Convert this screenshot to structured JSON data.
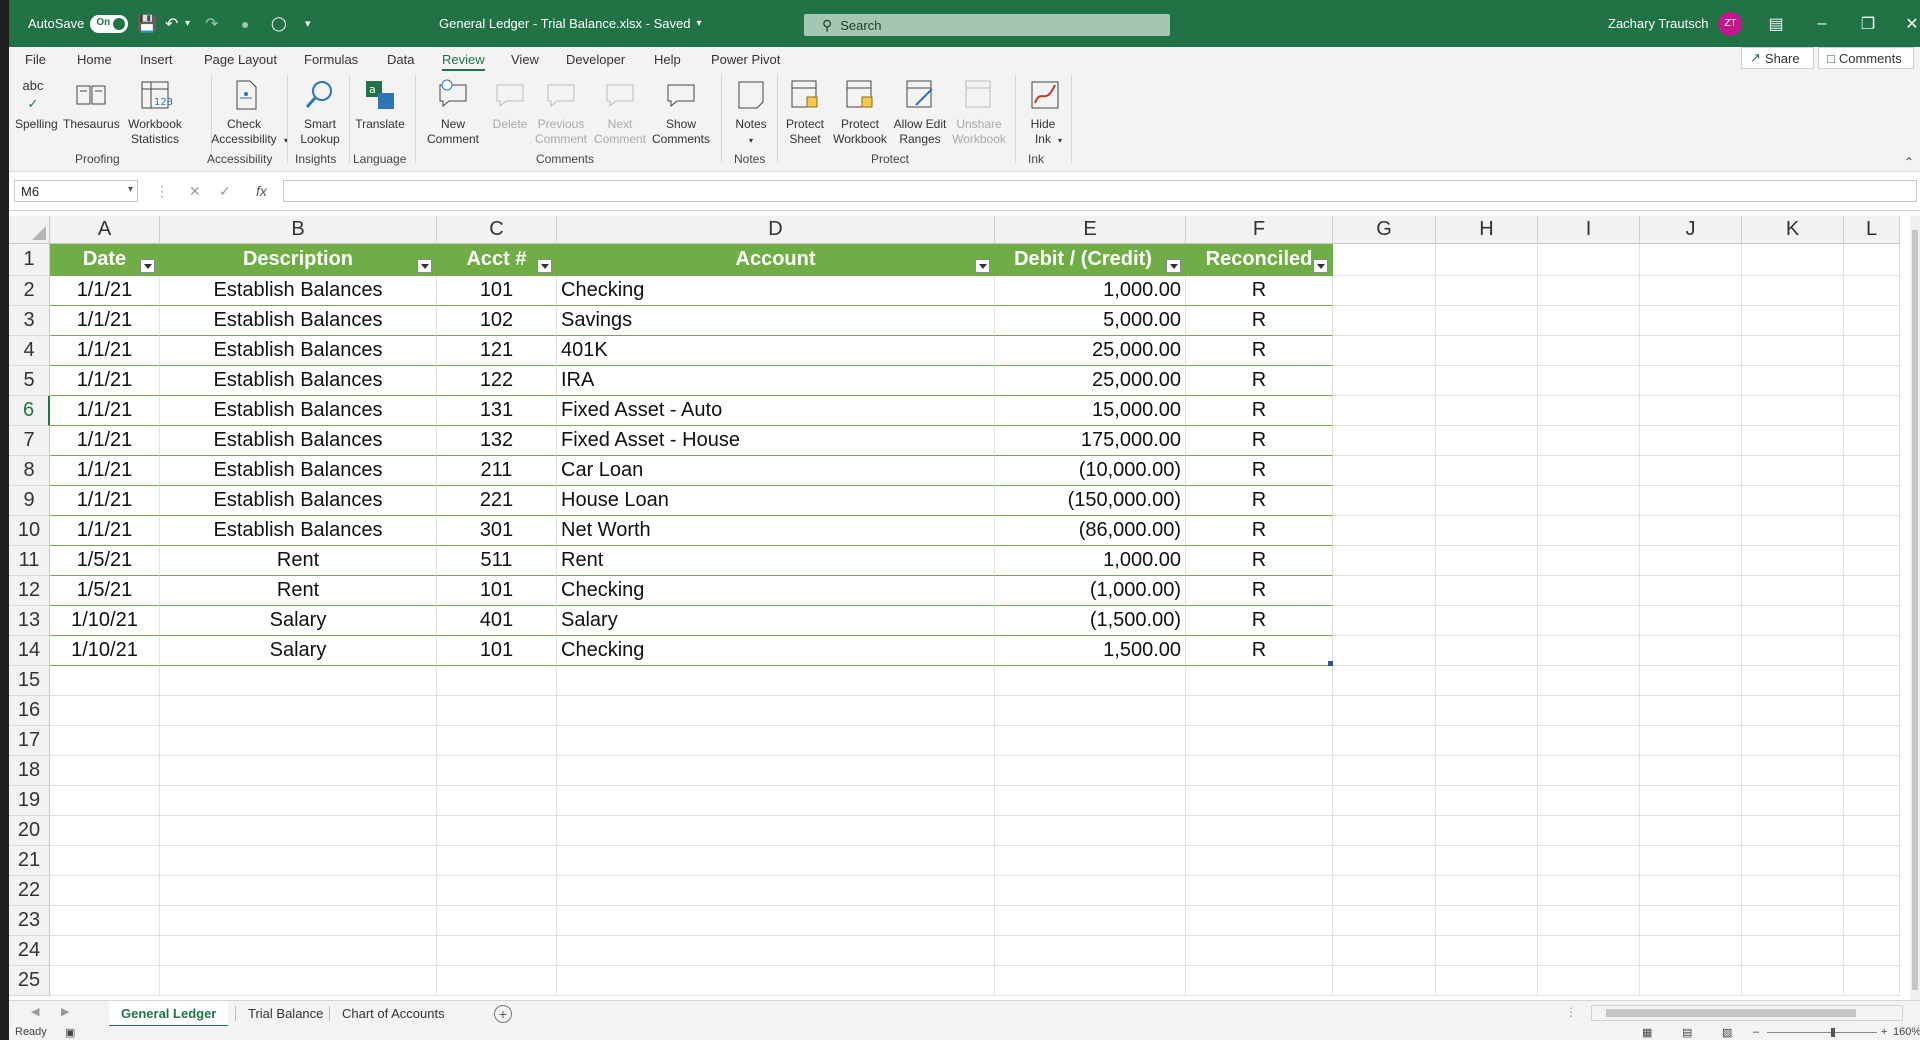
{
  "titlebar": {
    "autosave_label": "AutoSave",
    "autosave_state": "On",
    "doc_title": "General Ledger - Trial Balance.xlsx  -  Saved",
    "search_placeholder": "Search",
    "user_name": "Zachary Trautsch",
    "user_initials": "ZT"
  },
  "menu": {
    "tabs": [
      "File",
      "Home",
      "Insert",
      "Page Layout",
      "Formulas",
      "Data",
      "Review",
      "View",
      "Developer",
      "Help",
      "Power Pivot"
    ],
    "active_tab": "Review",
    "share_label": "Share",
    "comments_label": "Comments"
  },
  "ribbon": {
    "buttons": {
      "spelling": "Spelling",
      "thesaurus": "Thesaurus",
      "workbook_statistics": "Workbook Statistics",
      "check_accessibility": "Check Accessibility",
      "smart_lookup": "Smart Lookup",
      "translate": "Translate",
      "new_comment": "New Comment",
      "delete": "Delete",
      "previous_comment": "Previous Comment",
      "next_comment": "Next Comment",
      "show_comments": "Show Comments",
      "notes": "Notes",
      "protect_sheet": "Protect Sheet",
      "protect_workbook": "Protect Workbook",
      "allow_edit_ranges": "Allow Edit Ranges",
      "unshare_workbook": "Unshare Workbook",
      "hide_ink": "Hide Ink"
    },
    "groups": [
      "Proofing",
      "Accessibility",
      "Insights",
      "Language",
      "Comments",
      "Notes",
      "Protect",
      "Ink"
    ],
    "spelling_icon_text": "abc"
  },
  "formula_bar": {
    "name_box": "M6",
    "fx_label": "fx",
    "formula": ""
  },
  "sheet": {
    "columns": [
      "A",
      "B",
      "C",
      "D",
      "E",
      "F",
      "G",
      "H",
      "I",
      "J",
      "K",
      "L"
    ],
    "row_numbers": [
      "1",
      "2",
      "3",
      "4",
      "5",
      "6",
      "7",
      "8",
      "9",
      "10",
      "11",
      "12",
      "13",
      "14",
      "15",
      "16",
      "17",
      "18",
      "19",
      "20",
      "21",
      "22",
      "23",
      "24",
      "25"
    ],
    "selected_row": "6",
    "header": [
      "Date",
      "Description",
      "Acct #",
      "Account",
      "Debit / (Credit)",
      "Reconciled"
    ],
    "rows": [
      [
        "1/1/21",
        "Establish Balances",
        "101",
        "Checking",
        "1,000.00",
        "R"
      ],
      [
        "1/1/21",
        "Establish Balances",
        "102",
        "Savings",
        "5,000.00",
        "R"
      ],
      [
        "1/1/21",
        "Establish Balances",
        "121",
        "401K",
        "25,000.00",
        "R"
      ],
      [
        "1/1/21",
        "Establish Balances",
        "122",
        "IRA",
        "25,000.00",
        "R"
      ],
      [
        "1/1/21",
        "Establish Balances",
        "131",
        "Fixed Asset - Auto",
        "15,000.00",
        "R"
      ],
      [
        "1/1/21",
        "Establish Balances",
        "132",
        "Fixed Asset - House",
        "175,000.00",
        "R"
      ],
      [
        "1/1/21",
        "Establish Balances",
        "211",
        "Car Loan",
        "(10,000.00)",
        "R"
      ],
      [
        "1/1/21",
        "Establish Balances",
        "221",
        "House Loan",
        "(150,000.00)",
        "R"
      ],
      [
        "1/1/21",
        "Establish Balances",
        "301",
        "Net Worth",
        "(86,000.00)",
        "R"
      ],
      [
        "1/5/21",
        "Rent",
        "511",
        "Rent",
        "1,000.00",
        "R"
      ],
      [
        "1/5/21",
        "Rent",
        "101",
        "Checking",
        "(1,000.00)",
        "R"
      ],
      [
        "1/10/21",
        "Salary",
        "401",
        "Salary",
        "(1,500.00)",
        "R"
      ],
      [
        "1/10/21",
        "Salary",
        "101",
        "Checking",
        "1,500.00",
        "R"
      ]
    ]
  },
  "sheet_tabs": {
    "tabs": [
      "General Ledger",
      "Trial Balance",
      "Chart of Accounts"
    ],
    "active": "General Ledger"
  },
  "status": {
    "ready": "Ready",
    "zoom": "160%"
  },
  "colors": {
    "excel_green": "#217346",
    "table_header": "#70ad47",
    "avatar": "#c2188b"
  }
}
